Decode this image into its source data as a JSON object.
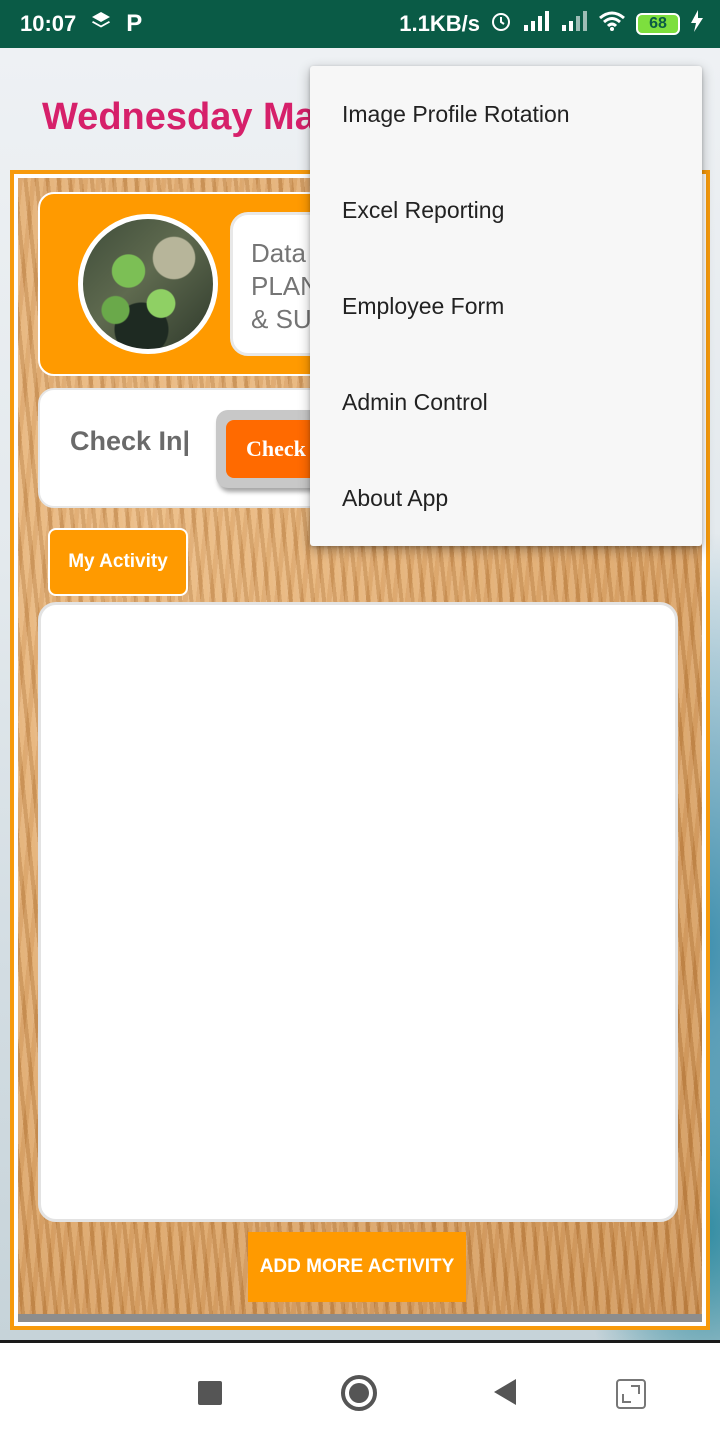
{
  "status_bar": {
    "time": "10:07",
    "network_speed": "1.1KB/s",
    "battery": "68",
    "icons": [
      "layers-icon",
      "p-icon",
      "alarm-icon",
      "signal-icon",
      "signal-icon",
      "wifi-icon",
      "battery-icon",
      "charging-icon"
    ]
  },
  "header": {
    "title": "Wednesday Ma"
  },
  "profile": {
    "info_line1": "Data",
    "info_line2": "PLAN",
    "info_line3": "& SU"
  },
  "checkin": {
    "label": "Check In|",
    "button_label": "Check"
  },
  "activity": {
    "tab_label": "My Activity",
    "add_button": "ADD MORE ACTIVITY"
  },
  "menu": {
    "items": [
      {
        "label": "Image Profile Rotation"
      },
      {
        "label": "Excel Reporting"
      },
      {
        "label": "Employee Form"
      },
      {
        "label": "Admin Control"
      },
      {
        "label": "About App"
      }
    ]
  },
  "colors": {
    "status_bar": "#0a5b46",
    "title": "#d6206a",
    "accent_orange": "#ff9a00",
    "checkin_orange": "#ff6a00"
  }
}
